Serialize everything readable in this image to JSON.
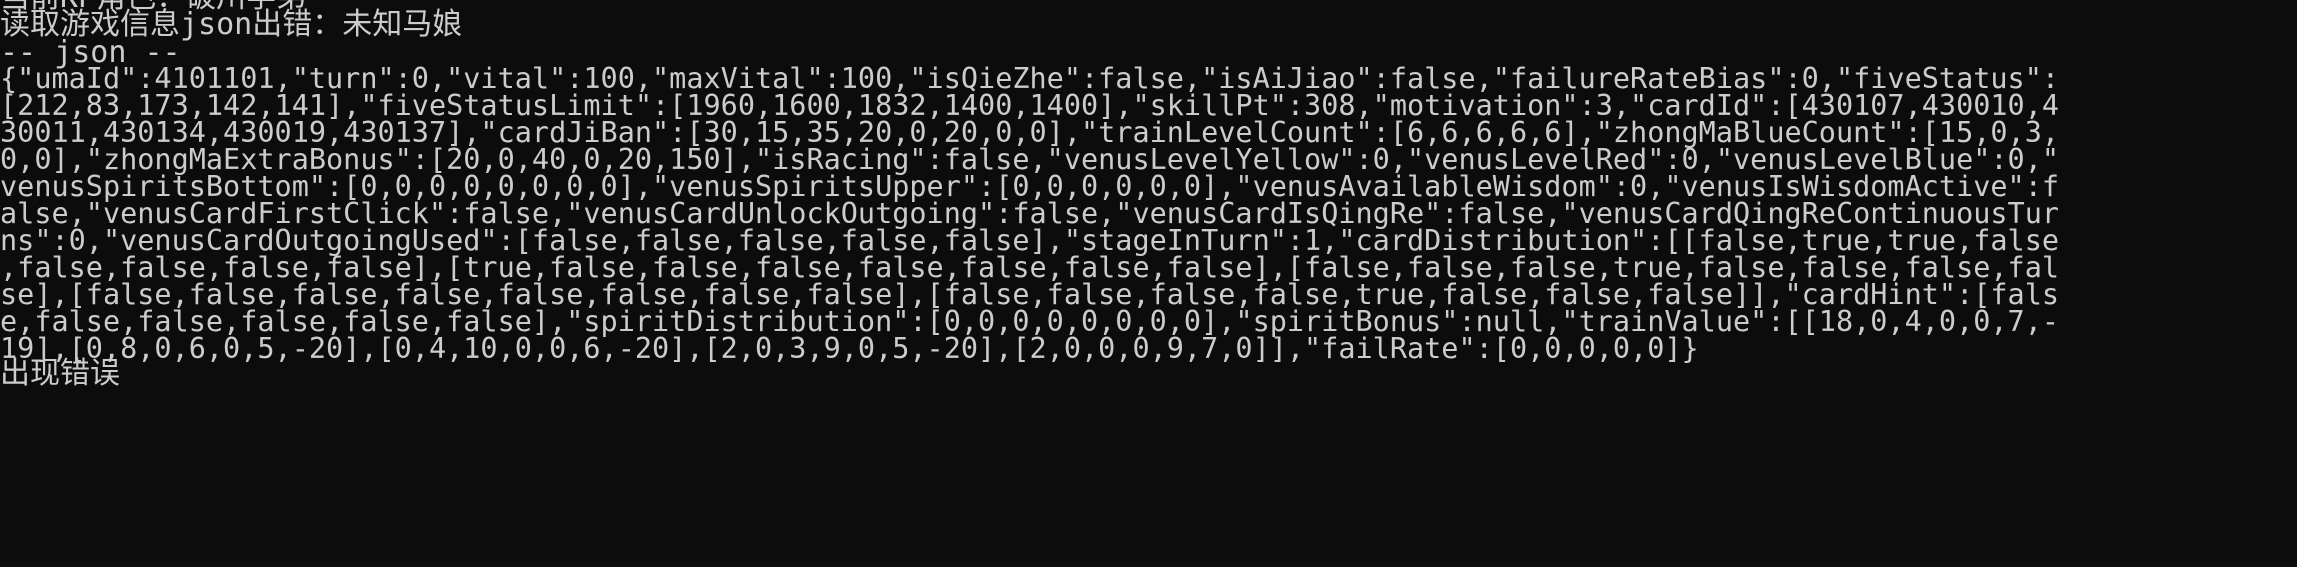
{
  "console": {
    "header_lines": [
      "当前KP角色：破川学弟",
      "读取游戏信息json出错：未知马娘",
      "-- json --"
    ],
    "json_lines": [
      "{\"umaId\":4101101,\"turn\":0,\"vital\":100,\"maxVital\":100,\"isQieZhe\":false,\"isAiJiao\":false,\"failureRateBias\":0,\"fiveStatus\":",
      "[212,83,173,142,141],\"fiveStatusLimit\":[1960,1600,1832,1400,1400],\"skillPt\":308,\"motivation\":3,\"cardId\":[430107,430010,4",
      "30011,430134,430019,430137],\"cardJiBan\":[30,15,35,20,0,20,0,0],\"trainLevelCount\":[6,6,6,6,6],\"zhongMaBlueCount\":[15,0,3,",
      "0,0],\"zhongMaExtraBonus\":[20,0,40,0,20,150],\"isRacing\":false,\"venusLevelYellow\":0,\"venusLevelRed\":0,\"venusLevelBlue\":0,\"",
      "venusSpiritsBottom\":[0,0,0,0,0,0,0,0],\"venusSpiritsUpper\":[0,0,0,0,0,0],\"venusAvailableWisdom\":0,\"venusIsWisdomActive\":f",
      "alse,\"venusCardFirstClick\":false,\"venusCardUnlockOutgoing\":false,\"venusCardIsQingRe\":false,\"venusCardQingReContinuousTur",
      "ns\":0,\"venusCardOutgoingUsed\":[false,false,false,false,false],\"stageInTurn\":1,\"cardDistribution\":[[false,true,true,false",
      ",false,false,false,false],[true,false,false,false,false,false,false,false],[false,false,false,true,false,false,false,fal",
      "se],[false,false,false,false,false,false,false,false],[false,false,false,false,true,false,false,false]],\"cardHint\":[fals",
      "e,false,false,false,false,false],\"spiritDistribution\":[0,0,0,0,0,0,0,0],\"spiritBonus\":null,\"trainValue\":[[18,0,4,0,0,7,-",
      "19],[0,8,0,6,0,5,-20],[0,4,10,0,0,6,-20],[2,0,3,9,0,5,-20],[2,0,0,0,9,7,0]],\"failRate\":[0,0,0,0,0]}"
    ],
    "footer_line": "出现错误"
  }
}
